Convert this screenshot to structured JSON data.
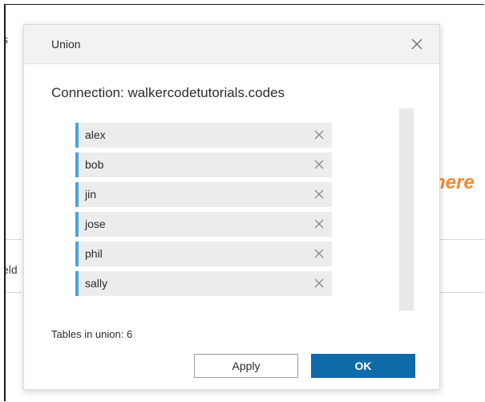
{
  "background": {
    "fragment_left_top": "s",
    "fragment_left_mid": "eld",
    "fragment_right": "here",
    "accent_color": "#f08a2c"
  },
  "dialog": {
    "title": "Union",
    "close_icon": "close-icon",
    "connection_label": "Connection: walkercodetutorials.codes",
    "tables": [
      {
        "name": "alex"
      },
      {
        "name": "bob"
      },
      {
        "name": "jin"
      },
      {
        "name": "jose"
      },
      {
        "name": "phil"
      },
      {
        "name": "sally"
      }
    ],
    "remove_icon": "close-icon",
    "tables_count_label": "Tables in union: 6",
    "apply_label": "Apply",
    "ok_label": "OK",
    "row_accent_color": "#4aa6d6",
    "primary_color": "#0f6aa8"
  }
}
